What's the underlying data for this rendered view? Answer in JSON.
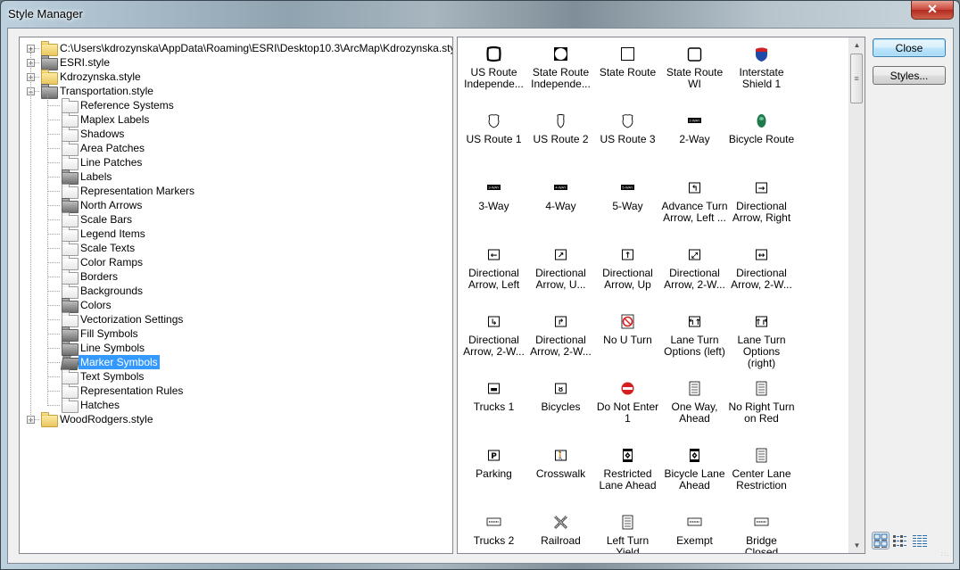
{
  "window": {
    "title": "Style Manager",
    "close_glyph": "✕"
  },
  "tree": {
    "roots": [
      {
        "label": "C:\\Users\\kdrozynska\\AppData\\Roaming\\ESRI\\Desktop10.3\\ArcMap\\Kdrozynska.style",
        "folder": "yellow",
        "expander": "+"
      },
      {
        "label": "ESRI.style",
        "folder": "gray",
        "expander": "+"
      },
      {
        "label": "Kdrozynska.style",
        "folder": "yellow",
        "expander": "+"
      },
      {
        "label": "Transportation.style",
        "folder": "gray",
        "expander": "−"
      }
    ],
    "children": [
      {
        "label": "Reference Systems",
        "folder": "open"
      },
      {
        "label": "Maplex Labels",
        "folder": "open"
      },
      {
        "label": "Shadows",
        "folder": "open"
      },
      {
        "label": "Area Patches",
        "folder": "open"
      },
      {
        "label": "Line Patches",
        "folder": "open"
      },
      {
        "label": "Labels",
        "folder": "gray"
      },
      {
        "label": "Representation Markers",
        "folder": "open"
      },
      {
        "label": "North Arrows",
        "folder": "gray"
      },
      {
        "label": "Scale Bars",
        "folder": "open"
      },
      {
        "label": "Legend Items",
        "folder": "open"
      },
      {
        "label": "Scale Texts",
        "folder": "open"
      },
      {
        "label": "Color Ramps",
        "folder": "open"
      },
      {
        "label": "Borders",
        "folder": "open"
      },
      {
        "label": "Backgrounds",
        "folder": "open"
      },
      {
        "label": "Colors",
        "folder": "gray"
      },
      {
        "label": "Vectorization Settings",
        "folder": "open"
      },
      {
        "label": "Fill Symbols",
        "folder": "gray"
      },
      {
        "label": "Line Symbols",
        "folder": "gray"
      },
      {
        "label": "Marker Symbols",
        "folder": "opengray",
        "selected": true
      },
      {
        "label": "Text Symbols",
        "folder": "open"
      },
      {
        "label": "Representation Rules",
        "folder": "open"
      },
      {
        "label": "Hatches",
        "folder": "open"
      }
    ],
    "trailing_root": {
      "label": "WoodRodgers.style",
      "folder": "yellow",
      "expander": "+"
    }
  },
  "gallery": {
    "items": [
      {
        "label": "US Route Independe...",
        "icon": "us-route-shield-bold"
      },
      {
        "label": "State Route Independe...",
        "icon": "state-route-circle"
      },
      {
        "label": "State Route",
        "icon": "state-route-square"
      },
      {
        "label": "State Route WI",
        "icon": "state-route-wi"
      },
      {
        "label": "Interstate Shield 1",
        "icon": "interstate-shield"
      },
      {
        "label": "US Route 1",
        "icon": "us-route-shield"
      },
      {
        "label": "US Route 2",
        "icon": "us-route-shield-narrow"
      },
      {
        "label": "US Route 3",
        "icon": "us-route-shield"
      },
      {
        "label": "2-Way",
        "icon": "plate",
        "plate_text": "2-WAY"
      },
      {
        "label": "Bicycle Route",
        "icon": "bicycle-route"
      },
      {
        "label": "3-Way",
        "icon": "plate",
        "plate_text": "3-WAY"
      },
      {
        "label": "4-Way",
        "icon": "plate",
        "plate_text": "4-WAY"
      },
      {
        "label": "5-Way",
        "icon": "plate",
        "plate_text": "5-WAY"
      },
      {
        "label": "Advance Turn Arrow, Left ...",
        "icon": "arrow-box",
        "arrow": "↰"
      },
      {
        "label": "Directional Arrow, Right",
        "icon": "arrow-box",
        "arrow": "→"
      },
      {
        "label": "Directional Arrow, Left",
        "icon": "arrow-box",
        "arrow": "←"
      },
      {
        "label": "Directional Arrow, U...",
        "icon": "arrow-box",
        "arrow": "↗"
      },
      {
        "label": "Directional Arrow, Up",
        "icon": "arrow-box",
        "arrow": "↑"
      },
      {
        "label": "Directional Arrow, 2-W...",
        "icon": "arrow-box",
        "arrow": "⤢"
      },
      {
        "label": "Directional Arrow, 2-W...",
        "icon": "arrow-box",
        "arrow": "↔"
      },
      {
        "label": "Directional Arrow, 2-W...",
        "icon": "arrow-box",
        "arrow": "↳"
      },
      {
        "label": "Directional Arrow, 2-W...",
        "icon": "arrow-box",
        "arrow": "↱"
      },
      {
        "label": "No U Turn",
        "icon": "no-u-turn"
      },
      {
        "label": "Lane Turn Options (left)",
        "icon": "arrow-box",
        "arrow": "↰↑"
      },
      {
        "label": "Lane Turn Options (right)",
        "icon": "arrow-box",
        "arrow": "↑↱"
      },
      {
        "label": "Trucks 1",
        "icon": "arrow-box",
        "arrow": "▬"
      },
      {
        "label": "Bicycles",
        "icon": "arrow-box",
        "arrow": "ᴕ"
      },
      {
        "label": "Do Not Enter 1",
        "icon": "do-not-enter"
      },
      {
        "label": "One Way, Ahead",
        "icon": "tall-sign",
        "sign_text": "ONE WAY ↑"
      },
      {
        "label": "No Right Turn on Red",
        "icon": "tall-sign",
        "sign_text": "NO RIGHT TURN"
      },
      {
        "label": "Parking",
        "icon": "arrow-box",
        "arrow": "P"
      },
      {
        "label": "Crosswalk",
        "icon": "arrow-box",
        "arrow": "🚶"
      },
      {
        "label": "Restricted Lane Ahead",
        "icon": "dark-sign"
      },
      {
        "label": "Bicycle Lane Ahead",
        "icon": "dark-sign"
      },
      {
        "label": "Center Lane Restriction",
        "icon": "tall-sign",
        "sign_text": "≡≡"
      },
      {
        "label": "Trucks 2",
        "icon": "wide-plate",
        "plate_text": "TRUCK"
      },
      {
        "label": "Railroad",
        "icon": "railroad"
      },
      {
        "label": "Left Turn Yield",
        "icon": "tall-sign",
        "sign_text": "YIELD ●"
      },
      {
        "label": "Exempt",
        "icon": "wide-plate",
        "plate_text": "EXEMPT"
      },
      {
        "label": "Bridge Closed",
        "icon": "wide-plate",
        "plate_text": "BRIDGE CLOSED"
      }
    ]
  },
  "buttons": {
    "close": "Close",
    "styles": "Styles..."
  },
  "view_modes": [
    {
      "name": "large-icons",
      "active": true
    },
    {
      "name": "list",
      "active": false
    },
    {
      "name": "details",
      "active": false
    }
  ]
}
